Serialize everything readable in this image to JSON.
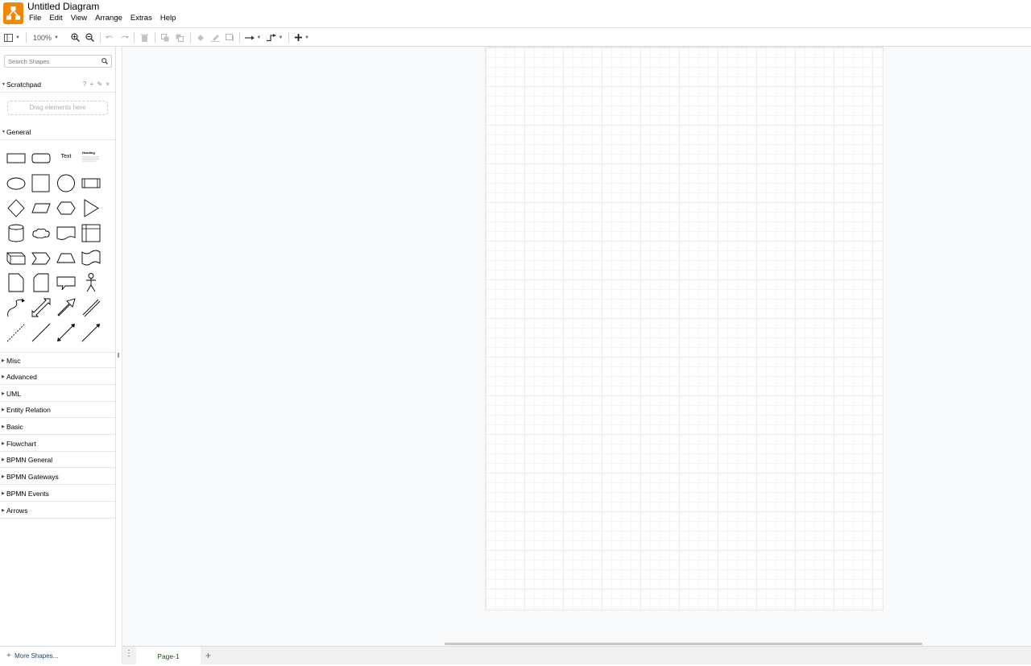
{
  "app": {
    "title": "Untitled Diagram",
    "brand_color": "#f08705"
  },
  "menu": [
    "File",
    "Edit",
    "View",
    "Arrange",
    "Extras",
    "Help"
  ],
  "toolbar": {
    "zoom": "100%"
  },
  "sidebar": {
    "search_placeholder": "Search Shapes",
    "scratchpad": {
      "title": "Scratchpad",
      "actions": "? + ✎ ×",
      "drop_hint": "Drag elements here"
    },
    "general_title": "General",
    "text_shape_label": "Text",
    "heading_shape_label": "Heading",
    "collapsed_sections": [
      "Misc",
      "Advanced",
      "UML",
      "Entity Relation",
      "Basic",
      "Flowchart",
      "BPMN General",
      "BPMN Gateways",
      "BPMN Events",
      "Arrows"
    ],
    "more_shapes": "More Shapes..."
  },
  "bottombar": {
    "page_tab": "Page-1",
    "add_page": "+"
  }
}
